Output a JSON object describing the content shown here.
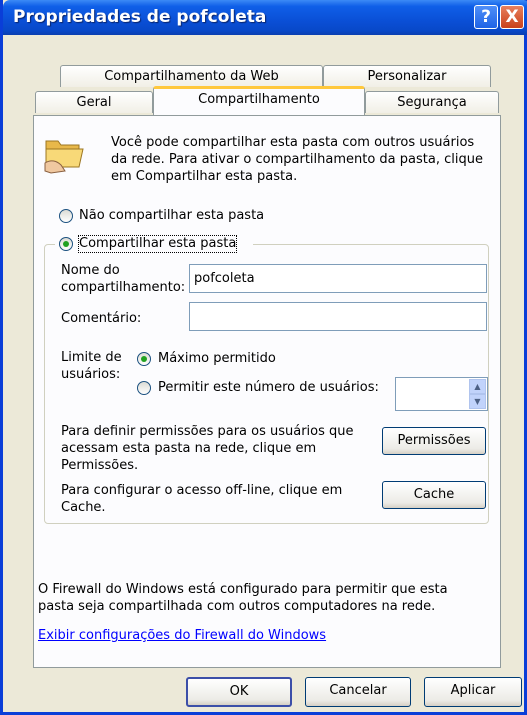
{
  "window": {
    "title": "Propriedades de pofcoleta"
  },
  "title_buttons": {
    "help": "?",
    "close": "X"
  },
  "tabs": {
    "row1": [
      "Compartilhamento da Web",
      "Personalizar"
    ],
    "row2": [
      "Geral",
      "Compartilhamento",
      "Segurança"
    ],
    "active": "Compartilhamento"
  },
  "info": {
    "line1": "Você pode compartilhar esta pasta com outros usuários",
    "line2": "da rede. Para ativar o compartilhamento da pasta, clique",
    "line3": "em Compartilhar esta pasta."
  },
  "sharing": {
    "no_share_label": "Não compartilhar esta pasta",
    "share_label": "Compartilhar esta pasta",
    "selected": "share"
  },
  "fields": {
    "share_name_label_1": "Nome do",
    "share_name_label_2": "compartilhamento:",
    "share_name_value": "pofcoleta",
    "comment_label": "Comentário:",
    "comment_value": ""
  },
  "user_limit": {
    "label_1": "Limite de",
    "label_2": "usuários:",
    "max_allowed": "Máximo permitido",
    "allow_number": "Permitir este número de usuários:",
    "selected": "max",
    "number_value": ""
  },
  "permissions": {
    "text_1": "Para definir permissões para os usuários que",
    "text_2": "acessam esta pasta na rede, clique em",
    "text_3": "Permissões.",
    "button": "Permissões"
  },
  "cache": {
    "text_1": "Para configurar o acesso off-line, clique em",
    "text_2": "Cache.",
    "button": "Cache"
  },
  "firewall": {
    "text_1": "O Firewall do Windows está configurado para permitir que esta",
    "text_2": "pasta seja compartilhada com outros computadores na rede.",
    "link": "Exibir configurações do Firewall do Windows"
  },
  "footer": {
    "ok": "OK",
    "cancel": "Cancelar",
    "apply": "Aplicar"
  },
  "icons": {
    "folder": "shared-folder-icon"
  }
}
